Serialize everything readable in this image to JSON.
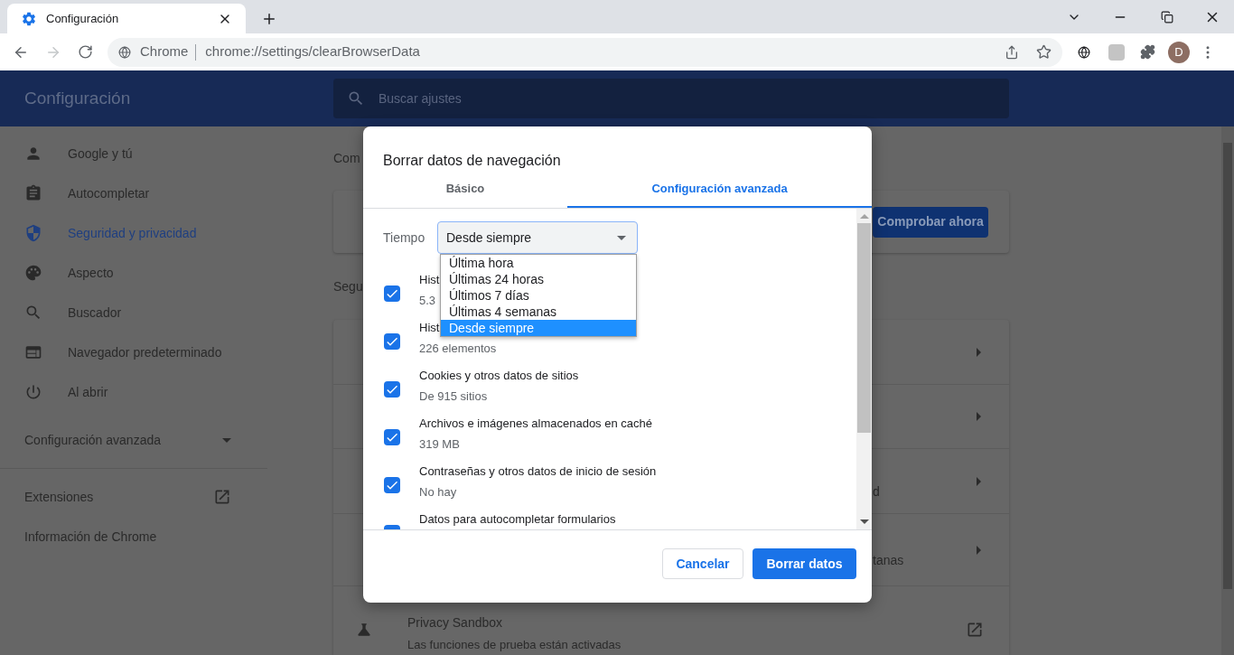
{
  "browser": {
    "tab": {
      "title": "Configuración"
    },
    "address": {
      "site_label": "Chrome",
      "url": "chrome://settings/clearBrowserData"
    },
    "profile_initial": "D"
  },
  "settings": {
    "title": "Configuración",
    "search": {
      "placeholder": "Buscar ajustes"
    },
    "sidebar": {
      "items": [
        {
          "label": "Google y tú",
          "selected": false
        },
        {
          "label": "Autocompletar",
          "selected": false
        },
        {
          "label": "Seguridad y privacidad",
          "selected": true
        },
        {
          "label": "Aspecto",
          "selected": false
        },
        {
          "label": "Buscador",
          "selected": false
        },
        {
          "label": "Navegador predeterminado",
          "selected": false
        },
        {
          "label": "Al abrir",
          "selected": false
        }
      ],
      "advanced": {
        "label": "Configuración avanzada",
        "expanded": false
      },
      "links": [
        {
          "label": "Extensiones",
          "external": true
        },
        {
          "label": "Información de Chrome",
          "external": false
        }
      ]
    },
    "content": {
      "heading_1": "Com",
      "check_button": "Comprobar ahora",
      "heading_2": "Segu",
      "rows": [
        {
          "kind": "arrow"
        },
        {
          "kind": "arrow"
        },
        {
          "kind": "arrow",
          "text": "d"
        },
        {
          "kind": "arrow",
          "text": "tanas"
        },
        {
          "kind": "external",
          "title": "Privacy Sandbox",
          "subtitle": "Las funciones de prueba están activadas"
        }
      ]
    }
  },
  "dialog": {
    "title": "Borrar datos de navegación",
    "tabs": [
      {
        "label": "Básico",
        "selected": false
      },
      {
        "label": "Configuración avanzada",
        "selected": true
      }
    ],
    "time": {
      "label": "Tiempo",
      "value": "Desde siempre",
      "options": [
        {
          "label": "Última hora",
          "selected": false
        },
        {
          "label": "Últimas 24 horas",
          "selected": false
        },
        {
          "label": "Últimos 7 días",
          "selected": false
        },
        {
          "label": "Últimas 4 semanas",
          "selected": false
        },
        {
          "label": "Desde siempre",
          "selected": true
        }
      ]
    },
    "items": [
      {
        "label": "Hist",
        "detail": "5.3",
        "checked": true
      },
      {
        "label": "Hist",
        "detail": "226 elementos",
        "checked": true
      },
      {
        "label": "Cookies y otros datos de sitios",
        "detail": "De 915 sitios",
        "checked": true
      },
      {
        "label": "Archivos e imágenes almacenados en caché",
        "detail": "319 MB",
        "checked": true
      },
      {
        "label": "Contraseñas y otros datos de inicio de sesión",
        "detail": "No hay",
        "checked": true
      },
      {
        "label": "Datos para autocompletar formularios",
        "checked": true
      }
    ],
    "buttons": [
      {
        "label": "Cancelar",
        "kind": "secondary"
      },
      {
        "label": "Borrar datos",
        "kind": "primary"
      }
    ]
  }
}
